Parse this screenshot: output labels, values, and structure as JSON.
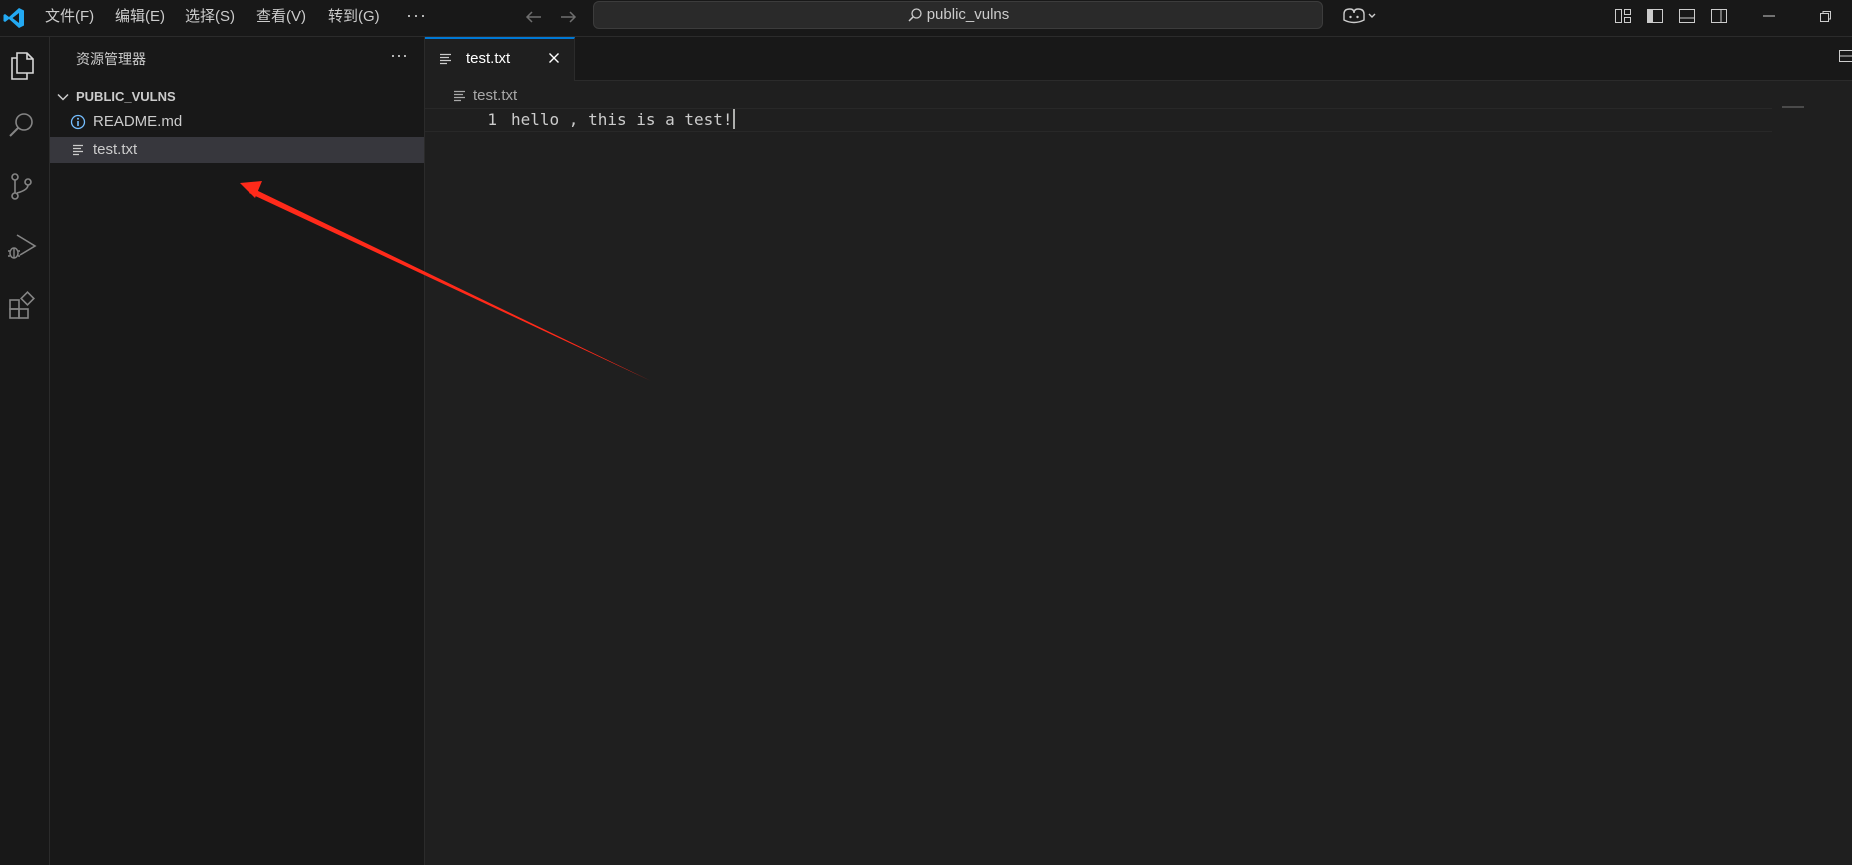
{
  "titlebar": {
    "menus": [
      "文件(F)",
      "编辑(E)",
      "选择(S)",
      "查看(V)",
      "转到(G)"
    ],
    "more": "···",
    "search_text": "public_vulns"
  },
  "sidebar": {
    "title": "资源管理器",
    "more": "···",
    "folder": "PUBLIC_VULNS",
    "files": [
      {
        "name": "README.md",
        "icon": "info-icon"
      },
      {
        "name": "test.txt",
        "icon": "text-file-icon",
        "selected": true
      }
    ]
  },
  "editor": {
    "tab_label": "test.txt",
    "breadcrumb": "test.txt",
    "lines": [
      {
        "number": "1",
        "text": "hello , this is a test!"
      }
    ]
  },
  "colors": {
    "accent": "#0078d4",
    "annotation_arrow": "#ff2a1a",
    "background": "#1f1f1f",
    "sidebar_bg": "#181818",
    "selection": "#37373d"
  }
}
